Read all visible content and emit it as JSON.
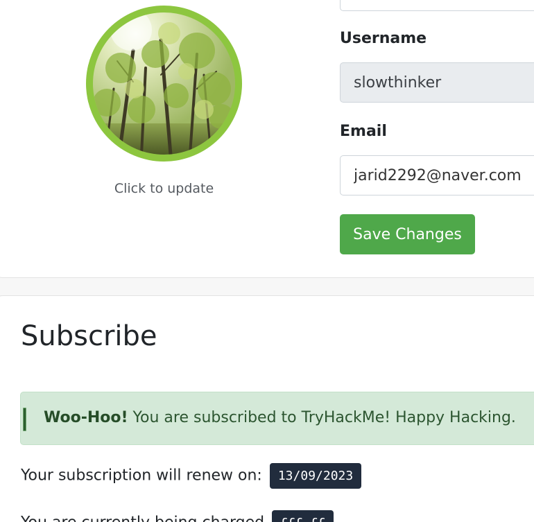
{
  "profile": {
    "avatar_caption": "Click to update",
    "username": {
      "label": "Username",
      "value": "slowthinker"
    },
    "email": {
      "label": "Email",
      "value": "jarid2292@naver.com"
    },
    "save_label": "Save Changes"
  },
  "subscribe": {
    "title": "Subscribe",
    "alert": {
      "strong": "Woo-Hoo!",
      "message": " You are subscribed to TryHackMe! Happy Hacking."
    },
    "renew_label": "Your subscription will renew on: ",
    "renew_date": "13/09/2023",
    "charged_label": "You are currently being charged ",
    "charged_amount": "£££.££"
  },
  "colors": {
    "accent_green": "#4fa84a",
    "avatar_ring": "#8dc63f",
    "alert_bg": "#d4e9d8",
    "badge_bg": "#212c3d"
  }
}
